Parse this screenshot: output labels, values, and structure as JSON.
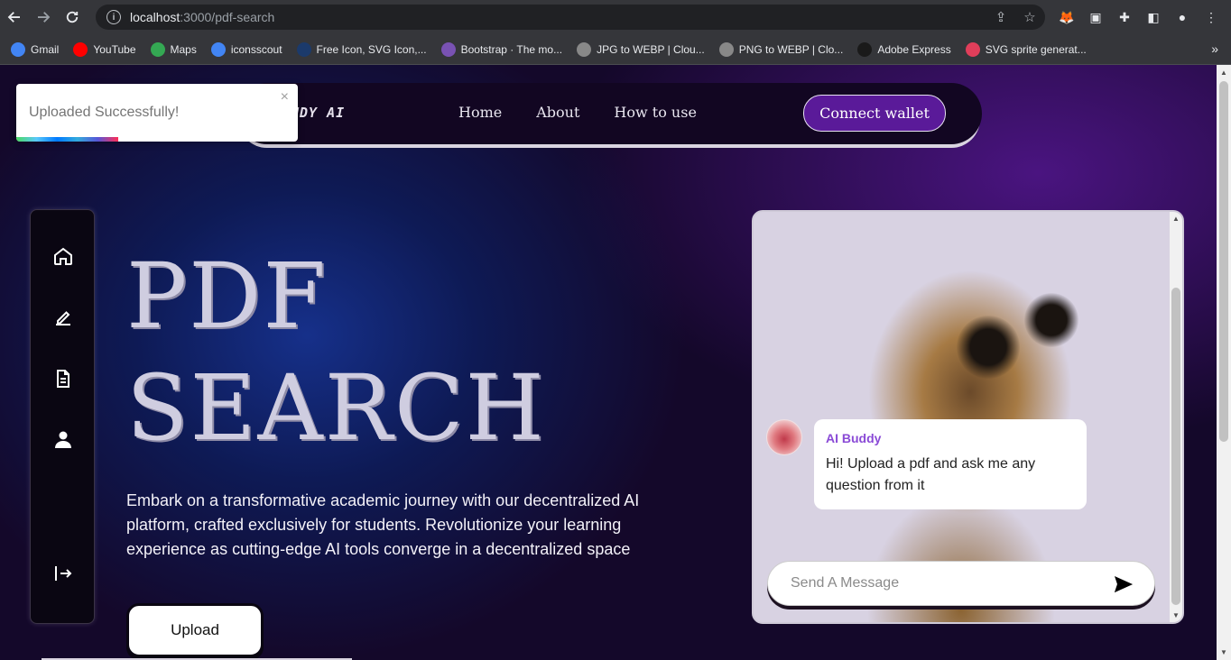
{
  "browser": {
    "url_host": "localhost",
    "url_rest": ":3000/pdf-search",
    "bookmarks": [
      {
        "label": "Gmail",
        "icon": "google-icon",
        "color": "#4285f4"
      },
      {
        "label": "YouTube",
        "icon": "youtube-icon",
        "color": "#ff0000"
      },
      {
        "label": "Maps",
        "icon": "maps-icon",
        "color": "#34a853"
      },
      {
        "label": "iconsscout",
        "icon": "google-icon",
        "color": "#4285f4"
      },
      {
        "label": "Free Icon, SVG Icon,...",
        "icon": "flaticon-icon",
        "color": "#1b3a6b"
      },
      {
        "label": "Bootstrap · The mo...",
        "icon": "bootstrap-icon",
        "color": "#7952b3"
      },
      {
        "label": "JPG to WEBP | Clou...",
        "icon": "cloud-icon",
        "color": "#888888"
      },
      {
        "label": "PNG to WEBP | Clo...",
        "icon": "cloud-icon",
        "color": "#888888"
      },
      {
        "label": "Adobe Express",
        "icon": "adobe-express-icon",
        "color": "#1a1a1a"
      },
      {
        "label": "SVG sprite generat...",
        "icon": "svg-sprite-icon",
        "color": "#e03e5a"
      }
    ],
    "more": "»"
  },
  "toast": {
    "message": "Uploaded Successfully!",
    "close": "×"
  },
  "navbar": {
    "brand": "UDY AI",
    "links": [
      "Home",
      "About",
      "How to use"
    ],
    "cta": "Connect wallet"
  },
  "sidebar": {
    "icons": [
      "home-icon",
      "edit-icon",
      "document-icon",
      "user-icon",
      "logout-icon"
    ]
  },
  "hero": {
    "title_line1": "PDF",
    "title_line2": "SEARCH",
    "description": "Embark on a transformative academic journey with our decentralized AI platform, crafted exclusively for students. Revolutionize your learning experience as cutting-edge AI tools converge in a decentralized space",
    "upload_label": "Upload"
  },
  "chat": {
    "sender": "AI Buddy",
    "message": "Hi! Upload a pdf and ask me any question from it",
    "input_placeholder": "Send A Message"
  }
}
